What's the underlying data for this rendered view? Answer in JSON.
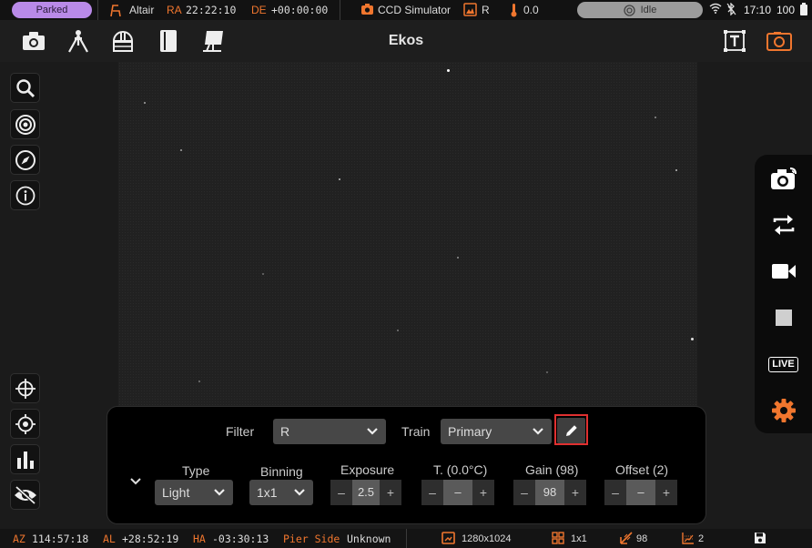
{
  "status": {
    "mount_state": "Parked",
    "target": "Altair",
    "ra_label": "RA",
    "ra_value": "22:22:10",
    "de_label": "DE",
    "de_value": "+00:00:00",
    "camera": "CCD Simulator",
    "filter": "R",
    "temperature": "0.0",
    "capture_state": "Idle",
    "time": "17:10",
    "battery": "100"
  },
  "toolbar": {
    "title": "Ekos",
    "icons": [
      "camera-icon",
      "mount-icon",
      "observatory-icon",
      "guide-book-icon",
      "flat-frame-icon",
      "text-overlay-icon",
      "capture-frame-icon"
    ]
  },
  "left_tools": [
    "zoom-icon",
    "target-icon",
    "compass-icon",
    "info-icon"
  ],
  "left_tools_bottom": [
    "crosshair-icon",
    "center-target-icon",
    "histogram-icon",
    "visibility-off-icon"
  ],
  "right_panel": {
    "live_label": "LIVE",
    "icons": [
      "capture-icon",
      "loop-icon",
      "video-icon",
      "stop-icon",
      "live-icon",
      "settings-icon"
    ]
  },
  "capture_panel": {
    "filter_label": "Filter",
    "filter_value": "R",
    "train_label": "Train",
    "train_value": "Primary",
    "type_label": "Type",
    "type_value": "Light",
    "binning_label": "Binning",
    "binning_value": "1x1",
    "exposure_label": "Exposure",
    "exposure_value": "2.5",
    "temp_label": "T. (0.0°C)",
    "temp_value": "–",
    "gain_label": "Gain (98)",
    "gain_value": "98",
    "offset_label": "Offset (2)",
    "offset_value": "–",
    "minus": "–",
    "plus": "+"
  },
  "bottom": {
    "az_label": "AZ",
    "az_value": "114:57:18",
    "al_label": "AL",
    "al_value": "+28:52:19",
    "ha_label": "HA",
    "ha_value": "-03:30:13",
    "pier_label": "Pier Side",
    "pier_value": "Unknown",
    "resolution": "1280x1024",
    "binning": "1x1",
    "gain": "98",
    "offset": "2"
  },
  "colors": {
    "accent": "#f0762e",
    "parked_badge": "#b98ae8",
    "idle_badge": "#9c9c9c",
    "edit_highlight": "#e03030"
  }
}
